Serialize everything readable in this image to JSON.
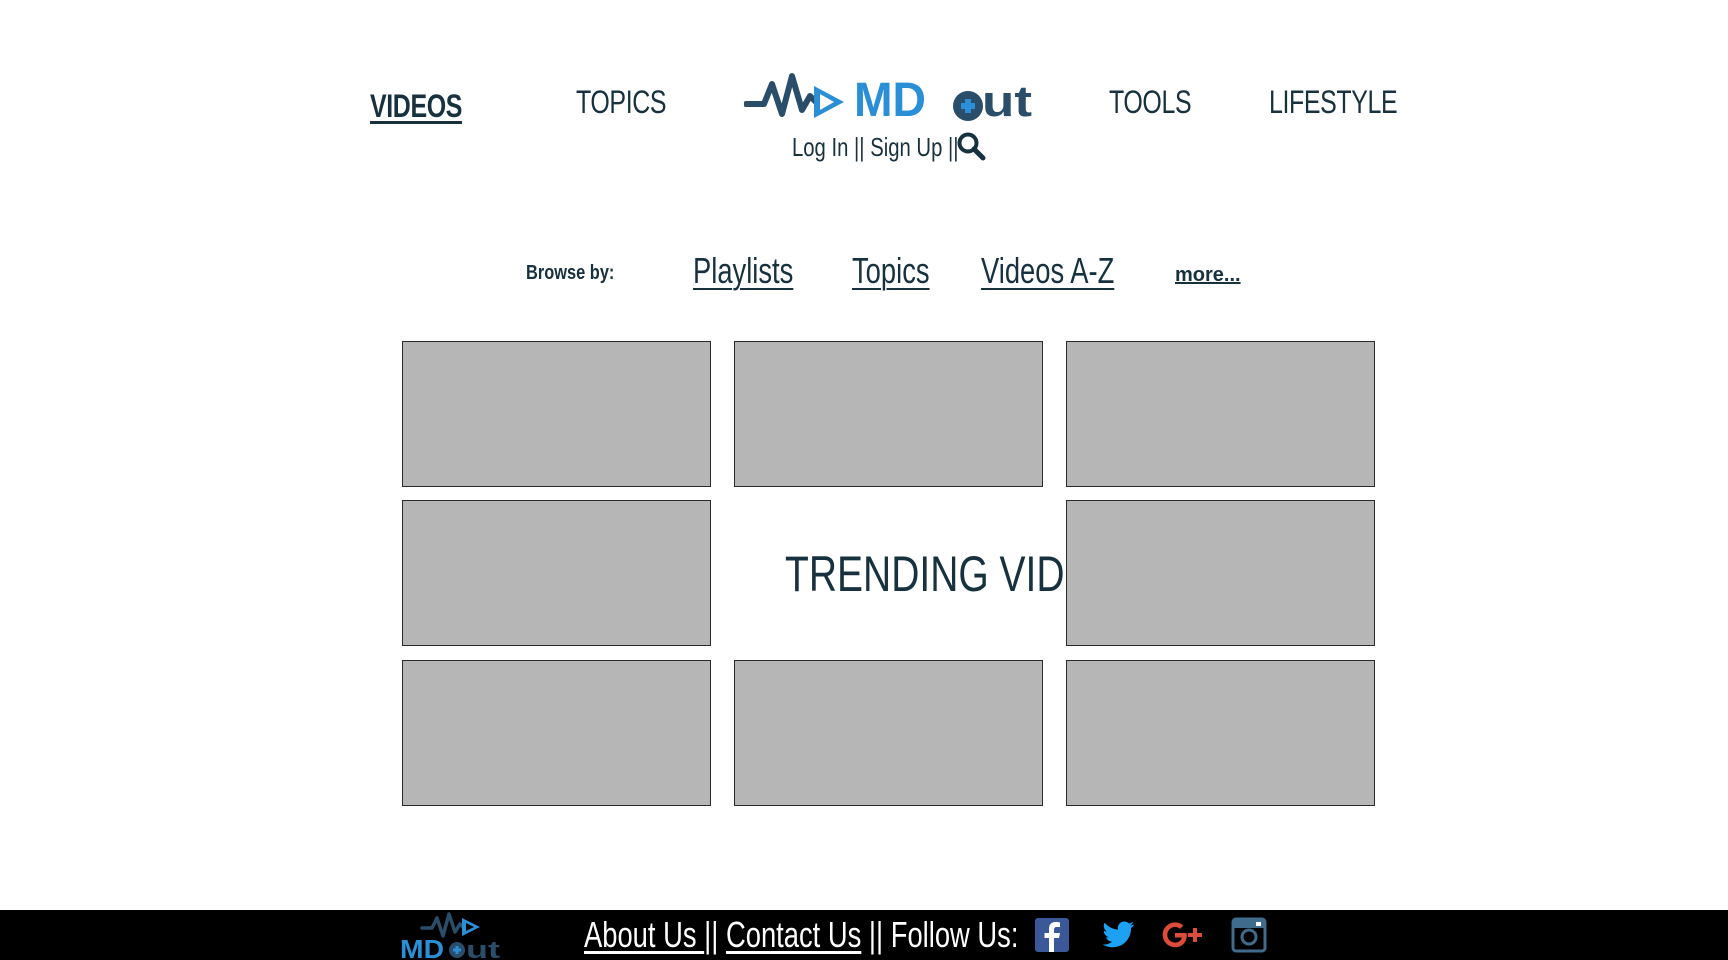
{
  "nav": {
    "videos": "VIDEOS",
    "topics": "TOPICS",
    "tools": "TOOLS",
    "lifestyle": "LIFESTYLE"
  },
  "logo": {
    "brand": "MDout"
  },
  "auth": {
    "login": "Log In",
    "separator1": " || ",
    "signup": "Sign Up",
    "separator2": " ||"
  },
  "browse": {
    "label": "Browse by:",
    "playlists": "Playlists",
    "topics": "Topics",
    "videos_az": "Videos A-Z",
    "more": "more..."
  },
  "main": {
    "trending_title": "TRENDING VIDEOS",
    "thumbnails": [
      "",
      "",
      "",
      "",
      "",
      "",
      "",
      ""
    ]
  },
  "footer": {
    "brand": "MDout",
    "about": "About Us ",
    "sep1": "|| ",
    "contact": "Contact Us",
    "follow": " || Follow Us:",
    "social": [
      "facebook-icon",
      "twitter-icon",
      "google-plus-icon",
      "instagram-icon"
    ]
  },
  "colors": {
    "text_dark": "#17313f",
    "logo_blue": "#2a8fd6",
    "logo_dark": "#2a4e6a",
    "thumb_gray": "#b6b6b6",
    "footer_bg": "#000000",
    "facebook": "#3b5998",
    "twitter": "#1da1f2",
    "google_plus": "#dd4b39",
    "instagram": "#3f6b8c"
  }
}
